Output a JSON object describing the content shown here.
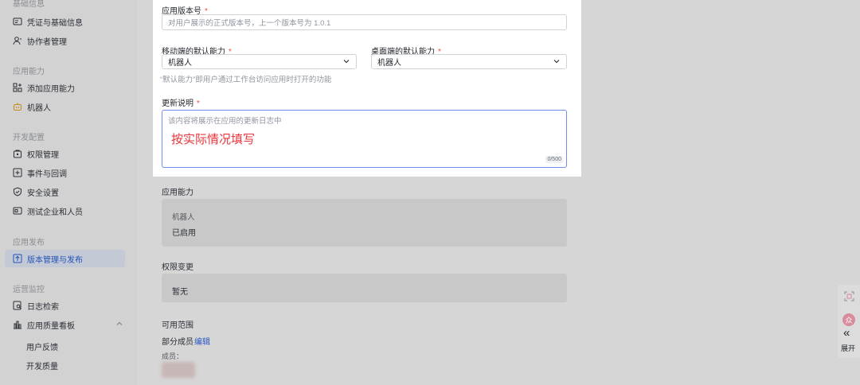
{
  "sidebar": {
    "sections": [
      {
        "title": "基础信息"
      },
      {
        "title": "应用能力"
      },
      {
        "title": "开发配置"
      },
      {
        "title": "应用发布"
      },
      {
        "title": "运营监控"
      }
    ],
    "items": [
      {
        "label": "凭证与基础信息",
        "icon": "credential-icon"
      },
      {
        "label": "协作者管理",
        "icon": "user-icon"
      },
      {
        "label": "添加应用能力",
        "icon": "add-capability-icon"
      },
      {
        "label": "机器人",
        "icon": "robot-icon"
      },
      {
        "label": "权限管理",
        "icon": "permission-icon"
      },
      {
        "label": "事件与回调",
        "icon": "event-icon"
      },
      {
        "label": "安全设置",
        "icon": "shield-icon"
      },
      {
        "label": "测试企业和人员",
        "icon": "test-org-icon"
      },
      {
        "label": "版本管理与发布",
        "icon": "version-icon",
        "active": true
      },
      {
        "label": "日志检索",
        "icon": "log-search-icon"
      },
      {
        "label": "应用质量看板",
        "icon": "chart-icon"
      }
    ],
    "sub_items": [
      "用户反馈",
      "开发质量"
    ]
  },
  "form": {
    "version": {
      "label": "应用版本号",
      "required": "*",
      "placeholder": "对用户展示的正式版本号，上一个版本号为 1.0.1"
    },
    "mobile_default": {
      "label": "移动端的默认能力",
      "required": "*",
      "value": "机器人"
    },
    "desktop_default": {
      "label": "桌面端的默认能力",
      "required": "*",
      "value": "机器人"
    },
    "hint": "“默认能力”即用户通过工作台访问应用时打开的功能",
    "update_notes": {
      "label": "更新说明",
      "required": "*",
      "placeholder": "该内容将展示在应用的更新日志中",
      "annotation": "按实际情况填写",
      "counter": "0/500"
    }
  },
  "details": {
    "capability": {
      "label": "应用能力",
      "name": "机器人",
      "status": "已启用"
    },
    "permission_change": {
      "label": "权限变更",
      "value": "暂无"
    },
    "availability": {
      "label": "可用范围",
      "scope": "部分成员",
      "edit": "编辑",
      "members_label": "成员："
    }
  },
  "float_bar": {
    "badge": "众",
    "expand_label": "展开"
  },
  "colors": {
    "accent": "#2b58c4",
    "required": "#f54a45",
    "annotation": "#e8343a",
    "active_bg": "#c4c9d6"
  }
}
